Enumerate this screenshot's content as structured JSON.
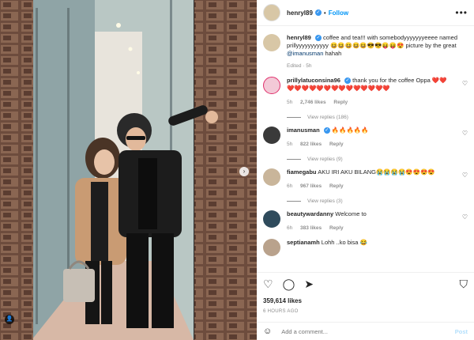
{
  "post": {
    "username": "henryl89",
    "follow_label": "Follow",
    "more_label": "•••",
    "caption_text": "coffee and tea!!! with somebodyyyyyyyeeee named prillyyyyyyyyyyy 😆😆😆😆😆😎😎😝😝😍 picture by the great",
    "caption_mention": "@imanusman",
    "caption_tail": "hahah",
    "caption_meta": "Edited · 5h",
    "likes": "359,614 likes",
    "time_ago": "6 HOURS AGO",
    "add_comment_placeholder": "Add a comment...",
    "post_label": "Post"
  },
  "comments": [
    {
      "username": "prillylatuconsina96",
      "verified": true,
      "text": "thank you for the coffee Oppa ❤️❤️❤️❤️❤️❤️❤️❤️❤️❤️❤️❤️❤️❤️❤️❤️",
      "time": "5h",
      "likes": "2,746 likes",
      "reply": "Reply",
      "view_replies": "View replies (186)"
    },
    {
      "username": "imanusman",
      "verified": true,
      "text": "🔥🔥🔥🔥🔥",
      "time": "5h",
      "likes": "822 likes",
      "reply": "Reply",
      "view_replies": "View replies (9)"
    },
    {
      "username": "fiamegabu",
      "verified": false,
      "text": "AKU IRI AKU BILANG😭😭😭😭😍😍😍😍",
      "time": "6h",
      "likes": "967 likes",
      "reply": "Reply",
      "view_replies": "View replies (3)"
    },
    {
      "username": "beautywardanny",
      "verified": false,
      "text": "Welcome to",
      "time": "6h",
      "likes": "383 likes",
      "reply": "Reply"
    },
    {
      "username": "septianamh",
      "verified": false,
      "text": "Lohh ..ko bisa 😂"
    }
  ],
  "icons": {
    "verified": "verified-badge-icon",
    "heart": "heart-icon",
    "comment": "comment-icon",
    "share": "share-icon",
    "save": "bookmark-icon",
    "emoji": "emoji-icon",
    "next": "chevron-right-icon",
    "user_tag": "user-tag-icon"
  },
  "colors": {
    "accent": "#0095f6",
    "verified": "#3897f0",
    "muted": "#8e8e8e",
    "text": "#262626"
  }
}
